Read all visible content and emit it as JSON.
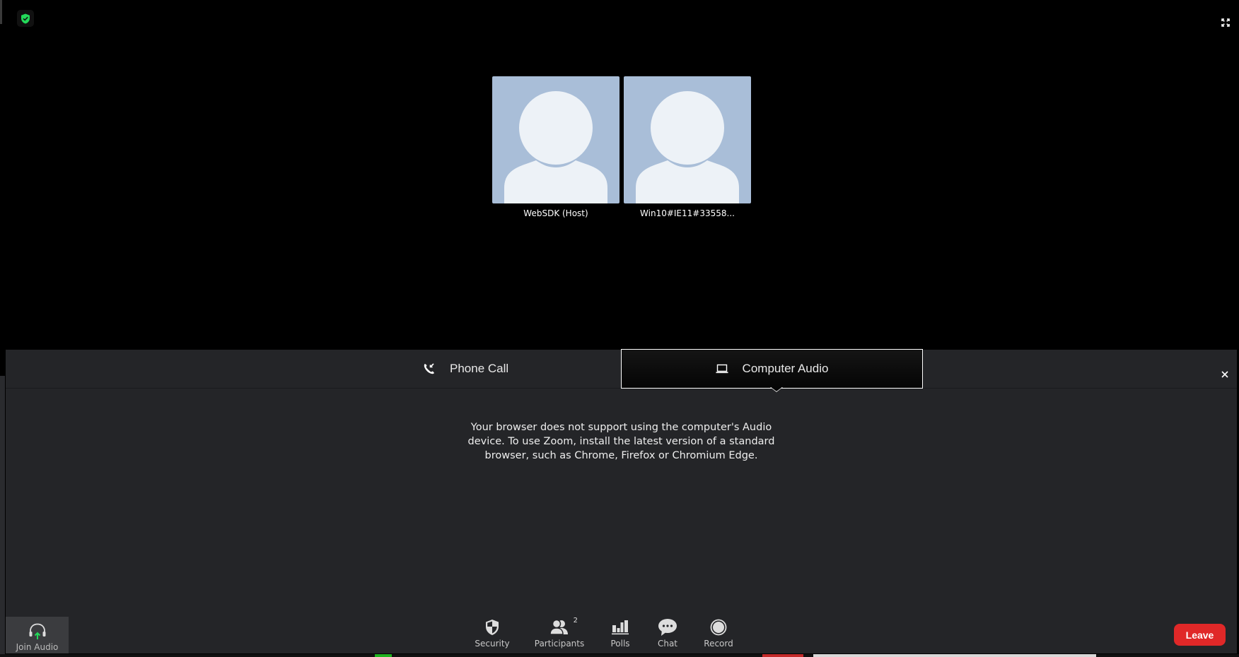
{
  "meeting": {
    "security_status": "encrypted",
    "participants": [
      {
        "name": "WebSDK (Host)"
      },
      {
        "name": "Win10#IE11#33558..."
      }
    ]
  },
  "audio_dialog": {
    "tabs": [
      {
        "label": "Phone Call",
        "icon": "phone-call-icon",
        "active": false
      },
      {
        "label": "Computer Audio",
        "icon": "laptop-icon",
        "active": true
      }
    ],
    "close_icon": "close-icon",
    "message_lines": [
      "Your browser does not support using the computer's Audio",
      "device. To use Zoom, install the latest version of a standard",
      "browser, such as Chrome, Firefox or Chromium Edge."
    ]
  },
  "toolbar": {
    "join_audio": {
      "label": "Join Audio",
      "icon": "headphones-icon"
    },
    "items": [
      {
        "label": "Security",
        "icon": "shield-icon"
      },
      {
        "label": "Participants",
        "icon": "participants-icon",
        "count": "2"
      },
      {
        "label": "Polls",
        "icon": "polls-icon"
      },
      {
        "label": "Chat",
        "icon": "chat-icon"
      },
      {
        "label": "Record",
        "icon": "record-icon"
      }
    ],
    "leave_label": "Leave"
  },
  "colors": {
    "accent_green": "#23d959",
    "leave_red": "#e02828",
    "avatar_bg": "#a9bed8",
    "panel_bg": "#242528"
  }
}
